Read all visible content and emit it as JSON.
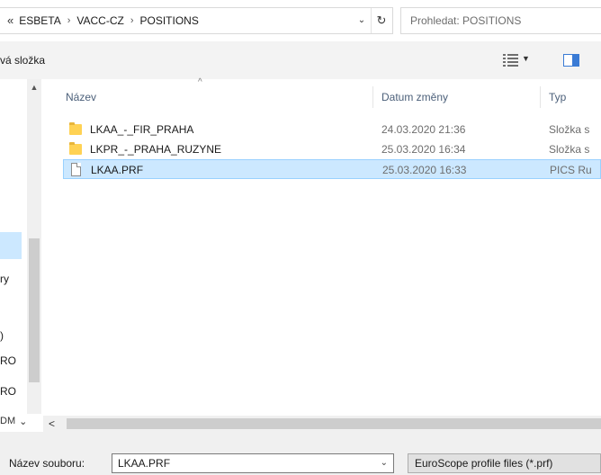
{
  "address_bar": {
    "overflow_chevron": "«",
    "crumbs": [
      "ESBETA",
      "VACC-CZ",
      "POSITIONS"
    ],
    "separator": "›",
    "dropdown_glyph": "⌄",
    "refresh_glyph": "↻"
  },
  "search": {
    "placeholder": "Prohledat: POSITIONS"
  },
  "toolbar": {
    "new_folder_label": "vá složka",
    "view_caret": "▼"
  },
  "nav_pane": {
    "up_arrow": "▲",
    "fragments": [
      "ry",
      ")",
      "RO",
      "RO"
    ],
    "bottom_fragment": "DM",
    "down_glyph": "⌄"
  },
  "columns": {
    "name": "Název",
    "date": "Datum změny",
    "type": "Typ",
    "sort_glyph": "^"
  },
  "files": [
    {
      "name": "LKAA_-_FIR_PRAHA",
      "date": "24.03.2020 21:36",
      "type": "Složka s",
      "icon": "folder-icon",
      "selected": false
    },
    {
      "name": "LKPR_-_PRAHA_RUZYNE",
      "date": "25.03.2020 16:34",
      "type": "Složka s",
      "icon": "folder-icon",
      "selected": false
    },
    {
      "name": "LKAA.PRF",
      "date": "25.03.2020 16:33",
      "type": "PICS Ru",
      "icon": "file-icon",
      "selected": true
    }
  ],
  "hscroll": {
    "left_arrow": "<"
  },
  "bottom": {
    "filename_label": "Název souboru:",
    "filename_value": "LKAA.PRF",
    "filename_dropdown": "⌄",
    "filetype_value": "EuroScope profile files (*.prf)"
  },
  "colors": {
    "selection_bg": "#cce8ff",
    "selection_border": "#99d1ff",
    "folder": "#ffd254",
    "header_text": "#4c607a"
  }
}
